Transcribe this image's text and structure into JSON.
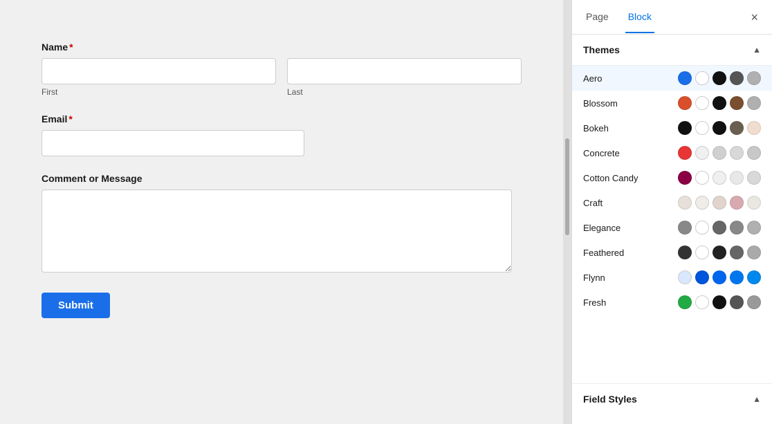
{
  "tabs": {
    "page_label": "Page",
    "block_label": "Block",
    "active": "Block"
  },
  "close_button": "×",
  "themes_section": {
    "label": "Themes",
    "chevron": "▲"
  },
  "field_styles_section": {
    "label": "Field Styles",
    "chevron": "▲"
  },
  "themes": [
    {
      "name": "Aero",
      "selected": true,
      "swatches": [
        "#1a6fe8",
        "#ffffff",
        "#111111",
        "#555555",
        "#b0b0b0"
      ]
    },
    {
      "name": "Blossom",
      "selected": false,
      "swatches": [
        "#d94f2b",
        "#ffffff",
        "#111111",
        "#7a4f30",
        "#b0b0b0"
      ]
    },
    {
      "name": "Bokeh",
      "selected": false,
      "swatches": [
        "#111111",
        "#ffffff",
        "#111111",
        "#6a6050",
        "#f0ddd0"
      ]
    },
    {
      "name": "Concrete",
      "selected": false,
      "swatches": [
        "#e83535",
        "#f0f0f0",
        "#d0d0d0",
        "#d8d8d8",
        "#c8c8c8"
      ]
    },
    {
      "name": "Cotton Candy",
      "selected": false,
      "swatches": [
        "#8b0045",
        "#ffffff",
        "#f0f0f0",
        "#e8e8e8",
        "#d8d8d8"
      ]
    },
    {
      "name": "Craft",
      "selected": false,
      "swatches": [
        "#e8e0d8",
        "#f0ece8",
        "#e0d4cc",
        "#d8aab0",
        "#e8e8e0"
      ]
    },
    {
      "name": "Elegance",
      "selected": false,
      "swatches": [
        "#888888",
        "#ffffff",
        "#666666",
        "#888888",
        "#b0b0b0"
      ]
    },
    {
      "name": "Feathered",
      "selected": false,
      "swatches": [
        "#333333",
        "#ffffff",
        "#222222",
        "#666666",
        "#aaaaaa"
      ]
    },
    {
      "name": "Flynn",
      "selected": false,
      "swatches": [
        "#d8e8ff",
        "#0055dd",
        "#0066ee",
        "#0077ee",
        "#0088ee"
      ]
    },
    {
      "name": "Fresh",
      "selected": false,
      "swatches": [
        "#22aa44",
        "#ffffff",
        "#111111",
        "#555555",
        "#999999"
      ]
    }
  ],
  "form": {
    "name_label": "Name",
    "first_label": "First",
    "last_label": "Last",
    "email_label": "Email",
    "message_label": "Comment or Message",
    "submit_label": "Submit"
  }
}
